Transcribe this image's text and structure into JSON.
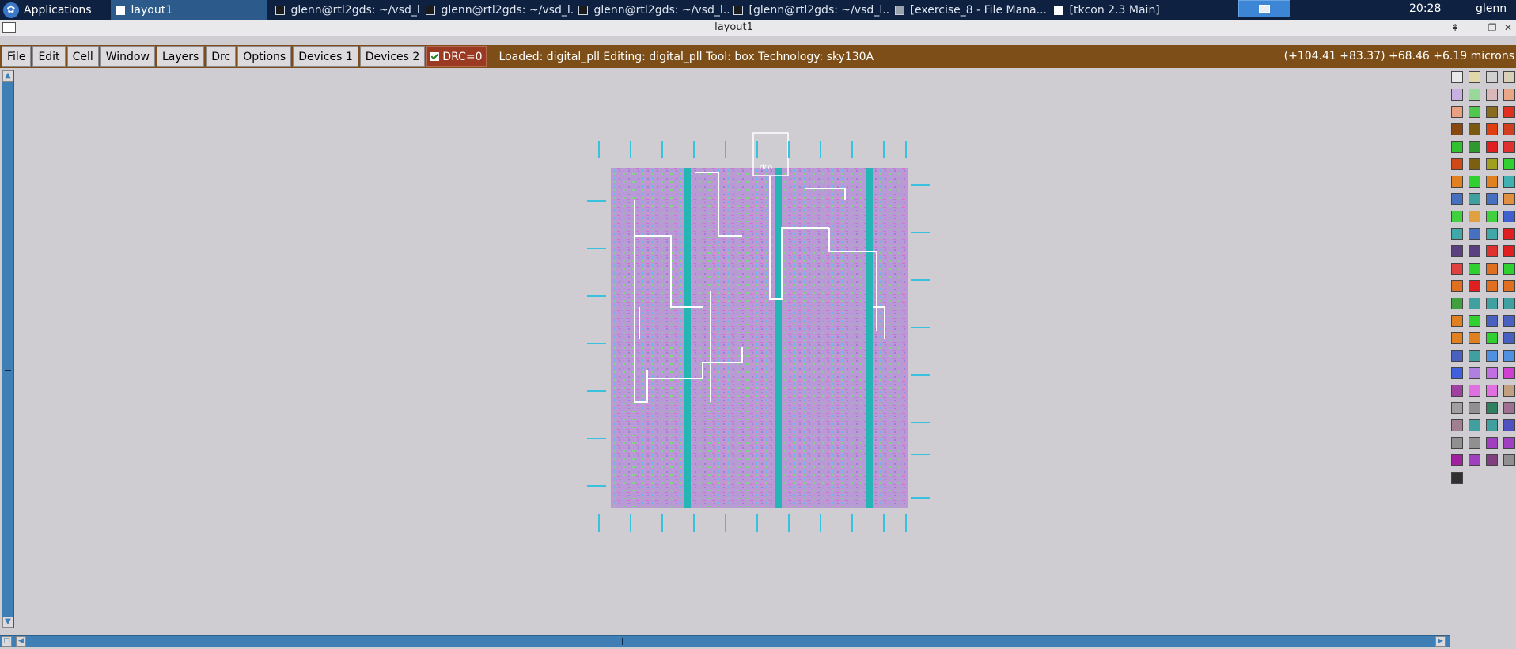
{
  "taskbar": {
    "apps_label": "Applications",
    "tasks": [
      {
        "label": "layout1",
        "active": true,
        "icon": "window-icon"
      },
      {
        "label": "glenn@rtl2gds: ~/vsd_l...",
        "active": false,
        "icon": "terminal-icon"
      },
      {
        "label": "glenn@rtl2gds: ~/vsd_l...",
        "active": false,
        "icon": "terminal-icon"
      },
      {
        "label": "glenn@rtl2gds: ~/vsd_l...",
        "active": false,
        "icon": "terminal-icon"
      },
      {
        "label": "[glenn@rtl2gds: ~/vsd_l...",
        "active": false,
        "icon": "terminal-icon"
      },
      {
        "label": "[exercise_8 - File Mana...",
        "active": false,
        "icon": "folder-icon"
      },
      {
        "label": "[tkcon 2.3 Main]",
        "active": false,
        "icon": "window-icon"
      }
    ],
    "clock": "20:28",
    "user": "glenn"
  },
  "window": {
    "title": "layout1"
  },
  "menubar": {
    "items": [
      "File",
      "Edit",
      "Cell",
      "Window",
      "Layers",
      "Drc",
      "Options",
      "Devices 1",
      "Devices 2"
    ],
    "drc_label": "DRC=0",
    "drc_checked": true,
    "status": "Loaded: digital_pll  Editing: digital_pll  Tool: box   Technology: sky130A",
    "coords": "(+104.41 +83.37) +68.46 +6.19 microns"
  },
  "canvas": {
    "cell_label": "dco",
    "colors": {
      "background": "#cfcdd1",
      "fill": "#b99ad6",
      "metal": "#25b5b5",
      "wire": "#ffffff",
      "pin": "#39c2e0"
    }
  },
  "palette": {
    "colors": [
      "#e8e8e8",
      "#e0d8a8",
      "#d0d0d0",
      "#d8d0b8",
      "#c8b0e0",
      "#98d898",
      "#d8b8b8",
      "#e8a888",
      "#e8a080",
      "#50c850",
      "#8a6a20",
      "#e03020",
      "#8a4810",
      "#7a5a10",
      "#e04010",
      "#d04020",
      "#30c030",
      "#309830",
      "#e02020",
      "#e03030",
      "#d04818",
      "#7a6010",
      "#a0a020",
      "#30d030",
      "#e08020",
      "#30d030",
      "#e08020",
      "#40b0b0",
      "#4870c0",
      "#40a0a0",
      "#4870c0",
      "#e09040",
      "#40d040",
      "#e0a040",
      "#40d040",
      "#4060d0",
      "#40a8a8",
      "#4870c0",
      "#40a8a8",
      "#e02020",
      "#5a4080",
      "#5a4080",
      "#e03030",
      "#e02020",
      "#e04040",
      "#30d030",
      "#e07020",
      "#30d030",
      "#e07020",
      "#e02020",
      "#e07020",
      "#e07020",
      "#40a040",
      "#40a0a0",
      "#40a0a0",
      "#40a0a0",
      "#e08020",
      "#30d030",
      "#4860c0",
      "#4860c0",
      "#e08020",
      "#e08020",
      "#30d030",
      "#4860c0",
      "#4860c0",
      "#40a0a0",
      "#5090e0",
      "#5090e0",
      "#4060e0",
      "#b080e0",
      "#c070e0",
      "#d040d0",
      "#a040a0",
      "#e070e0",
      "#e070e0",
      "#c0a080",
      "#a0a0a0",
      "#909090",
      "#308060",
      "#a07090",
      "#a08090",
      "#40a0a0",
      "#40a0a0",
      "#5050c0",
      "#909090",
      "#909090",
      "#a040c0",
      "#a040c0",
      "#a020a0",
      "#a040c0",
      "#804080",
      "#909090",
      "#303030"
    ]
  }
}
